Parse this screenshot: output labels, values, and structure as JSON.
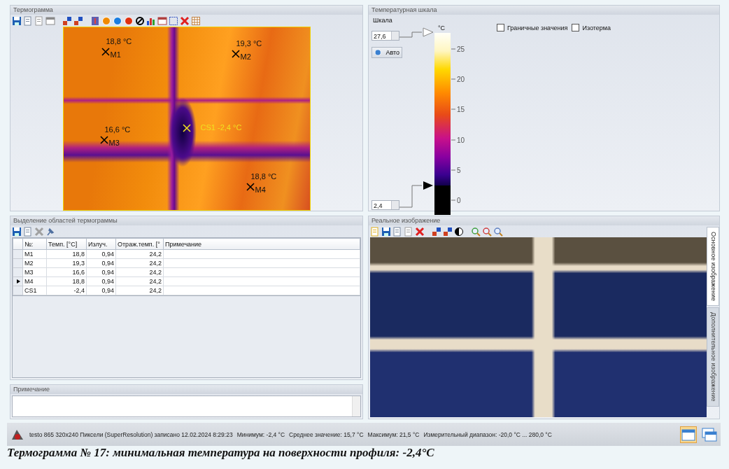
{
  "thermogram": {
    "title": "Термограмма",
    "markers": [
      {
        "kind": "point",
        "name": "M1",
        "temp": "18,8 °C"
      },
      {
        "kind": "point",
        "name": "M2",
        "temp": "19,3 °C"
      },
      {
        "kind": "point",
        "name": "M3",
        "temp": "16,6 °C"
      },
      {
        "kind": "coldspot",
        "name": "CS1",
        "temp": "-2,4 °C"
      },
      {
        "kind": "point",
        "name": "M4",
        "temp": "18,8 °C"
      }
    ]
  },
  "temperature_scale": {
    "title": "Температурная шкала",
    "scale_label": "Шкала",
    "max_value": "27,6",
    "auto_button": "Авто",
    "unit": "°C",
    "ticks": [
      "25",
      "20",
      "15",
      "10",
      "5",
      "0"
    ],
    "min_value": "2,4",
    "options": [
      {
        "label": "Граничные значения",
        "checked": false
      },
      {
        "label": "Изотерма",
        "checked": false
      }
    ]
  },
  "regions": {
    "title": "Выделение областей термограммы",
    "columns": [
      "№:",
      "Темп. [°C]",
      "Излуч.",
      "Отраж.темп. [°",
      "Примечание"
    ],
    "rows": [
      {
        "id": "M1",
        "temp": "18,8",
        "emissivity": "0,94",
        "reflected": "24,2",
        "selected": false
      },
      {
        "id": "M2",
        "temp": "19,3",
        "emissivity": "0,94",
        "reflected": "24,2",
        "selected": false
      },
      {
        "id": "M3",
        "temp": "16,6",
        "emissivity": "0,94",
        "reflected": "24,2",
        "selected": false
      },
      {
        "id": "M4",
        "temp": "18,8",
        "emissivity": "0,94",
        "reflected": "24,2",
        "selected": true
      },
      {
        "id": "CS1",
        "temp": "-2,4",
        "emissivity": "0,94",
        "reflected": "24,2",
        "selected": false
      }
    ]
  },
  "note": {
    "title": "Примечание"
  },
  "real_image": {
    "title": "Реальное изображение",
    "tabs": [
      {
        "label": "Основное изображение",
        "selected": true
      },
      {
        "label": "Дополнительное изображение",
        "selected": false
      }
    ]
  },
  "status_bar": {
    "items": [
      "testo 865 320x240 Пиксели (SuperResolution) записано 12.02.2024 8:29:23",
      "Минимум: -2,4 °C",
      "Среднее значение: 15,7 °C",
      "Максимум: 21,5 °C",
      "Измерительный диапазон: -20,0 °C ... 280,0 °C"
    ]
  },
  "caption": "Термограмма № 17: минимальная температура на поверхности профиля: -2,4°C"
}
